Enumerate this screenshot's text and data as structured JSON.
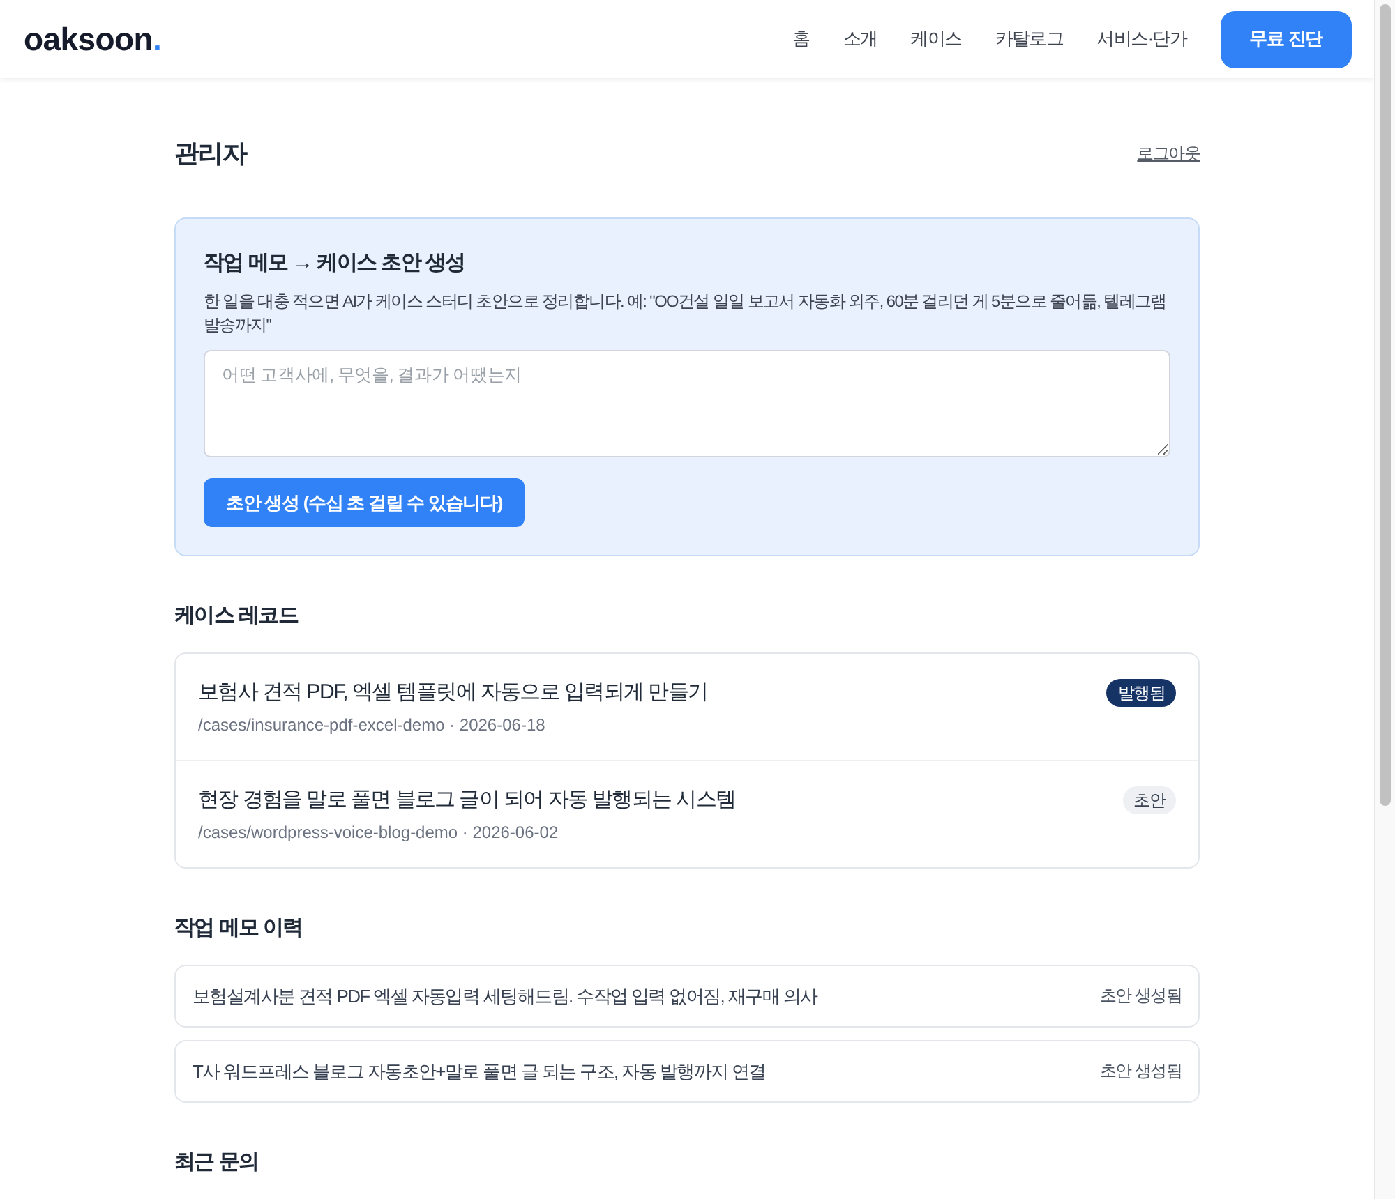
{
  "header": {
    "logo": {
      "text": "oaksoon",
      "accent": "."
    },
    "nav": [
      "홈",
      "소개",
      "케이스",
      "카탈로그",
      "서비스·단가"
    ],
    "cta": "무료 진단"
  },
  "page": {
    "title": "관리자",
    "logout": "로그아웃"
  },
  "memo_form": {
    "title": "작업 메모 → 케이스 초안 생성",
    "description": "한 일을 대충 적으면 AI가 케이스 스터디 초안으로 정리합니다. 예: \"OO건설 일일 보고서 자동화 외주, 60분 걸리던 게 5분으로 줄어듦, 텔레그램 발송까지\"",
    "placeholder": "어떤 고객사에, 무엇을, 결과가 어땠는지",
    "button": "초안 생성 (수십 초 걸릴 수 있습니다)"
  },
  "case_records": {
    "heading": "케이스 레코드",
    "rows": [
      {
        "title": "보험사 견적 PDF, 엑셀 템플릿에 자동으로 입력되게 만들기",
        "meta": "/cases/insurance-pdf-excel-demo · 2026-06-18",
        "status": "발행됨",
        "kind": "published"
      },
      {
        "title": "현장 경험을 말로 풀면 블로그 글이 되어 자동 발행되는 시스템",
        "meta": "/cases/wordpress-voice-blog-demo · 2026-06-02",
        "status": "초안",
        "kind": "draft"
      }
    ]
  },
  "memo_history": {
    "heading": "작업 메모 이력",
    "items": [
      {
        "text": "보험설계사분 견적 PDF 엑셀 자동입력 세팅해드림. 수작업 입력 없어짐, 재구매 의사",
        "status": "초안 생성됨"
      },
      {
        "text": "T사 워드프레스 블로그 자동초안+말로 풀면 글 되는 구조, 자동 발행까지 연결",
        "status": "초안 생성됨"
      }
    ]
  },
  "inquiries": {
    "heading": "최근 문의"
  }
}
